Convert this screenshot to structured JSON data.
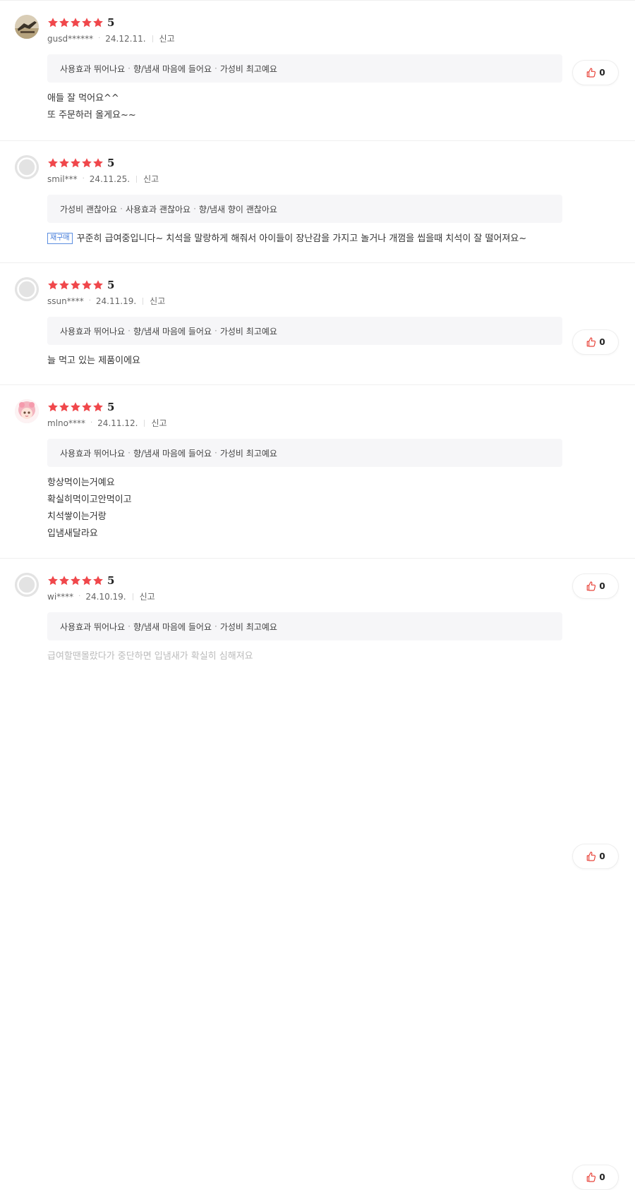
{
  "colors": {
    "star": "#f0474b",
    "like_icon": "#e8443a",
    "rebuy_badge": "#3f78d9",
    "tags_background": "#f6f6f8"
  },
  "reviews": [
    {
      "avatar": "photo-avatar",
      "rating_stars": 5,
      "score": "5",
      "username": "gusd******",
      "date": "24.12.11.",
      "report": "신고",
      "tags": [
        "사용효과 뛰어나요",
        "향/냄새 마음에 들어요",
        "가성비 최고예요"
      ],
      "likes": "0",
      "rebuy": null,
      "lines": [
        "애들 잘 먹어요^^",
        "또 주문하러 올게요~~"
      ]
    },
    {
      "avatar": "default-avatar",
      "rating_stars": 5,
      "score": "5",
      "username": "smil***",
      "date": "24.11.25.",
      "report": "신고",
      "tags": [
        "가성비 괜찮아요",
        "사용효과 괜찮아요",
        "향/냄새 향이 괜찮아요"
      ],
      "likes": "0",
      "rebuy": "재구매",
      "lines": [
        "꾸준히 급여중입니다~ 치석을 말랑하게 해줘서 아이들이 장난감을 가지고 놀거나 개껌을 씹을때 치석이 잘 떨어져요~"
      ]
    },
    {
      "avatar": "default-avatar",
      "rating_stars": 5,
      "score": "5",
      "username": "ssun****",
      "date": "24.11.19.",
      "report": "신고",
      "tags": [
        "사용효과 뛰어나요",
        "향/냄새 마음에 들어요",
        "가성비 최고예요"
      ],
      "likes": "0",
      "rebuy": null,
      "lines": [
        "늘 먹고 있는 제품이에요"
      ]
    },
    {
      "avatar": "character-avatar",
      "rating_stars": 5,
      "score": "5",
      "username": "mlno****",
      "date": "24.11.12.",
      "report": "신고",
      "tags": [
        "사용효과 뛰어나요",
        "향/냄새 마음에 들어요",
        "가성비 최고예요"
      ],
      "likes": "0",
      "rebuy": null,
      "lines": [
        "항상먹이는거예요",
        "확실히먹이고안먹이고",
        "치석쌓이는거랑",
        "입냄새달라요"
      ]
    },
    {
      "avatar": "default-avatar",
      "rating_stars": 5,
      "score": "5",
      "username": "wi****",
      "date": "24.10.19.",
      "report": "신고",
      "tags": [
        "사용효과 뛰어나요",
        "향/냄새 마음에 들어요",
        "가성비 최고예요"
      ],
      "likes": "0",
      "rebuy": null,
      "lines": [
        "급여할땐몰랐다가 중단하면 입냄새가 확실히 심해져요"
      ]
    }
  ]
}
